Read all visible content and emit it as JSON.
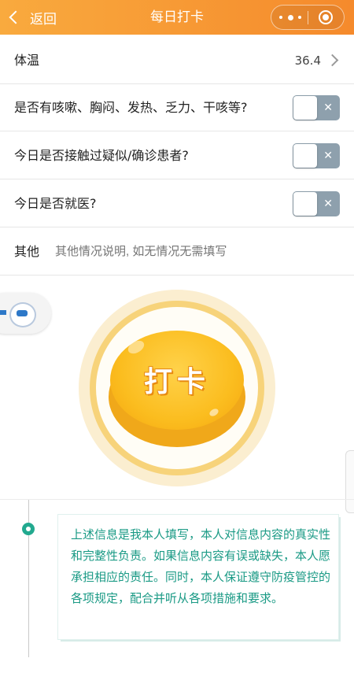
{
  "nav": {
    "back_label": "返回",
    "title": "每日打卡"
  },
  "form": {
    "temperature": {
      "label": "体温",
      "value": "36.4"
    },
    "questions": [
      {
        "label": "是否有咳嗽、胸闷、发热、乏力、干咳等?",
        "on": false
      },
      {
        "label": "今日是否接触过疑似/确诊患者?",
        "on": false
      },
      {
        "label": "今日是否就医?",
        "on": false
      }
    ],
    "other": {
      "label": "其他",
      "placeholder": "其他情况说明, 如无情况无需填写"
    }
  },
  "checkin_button": {
    "label": "打卡"
  },
  "notice": {
    "text": "上述信息是我本人填写，本人对信息内容的真实性和完整性负责。如果信息内容有误或缺失，本人愿承担相应的责任。同时，本人保证遵守防疫管控的各项规定，配合并听从各项措施和要求。"
  },
  "colors": {
    "nav_bg": "#f59a33",
    "toggle_off": "#8ea0ad",
    "notice_text": "#1a9a85",
    "button": "#fbbd1f"
  },
  "icons": {
    "back": "chevron-left-icon",
    "more": "more-dots-icon",
    "close_app": "target-circle-icon",
    "arrow": "chevron-right-icon",
    "toggle_x": "close-icon"
  }
}
